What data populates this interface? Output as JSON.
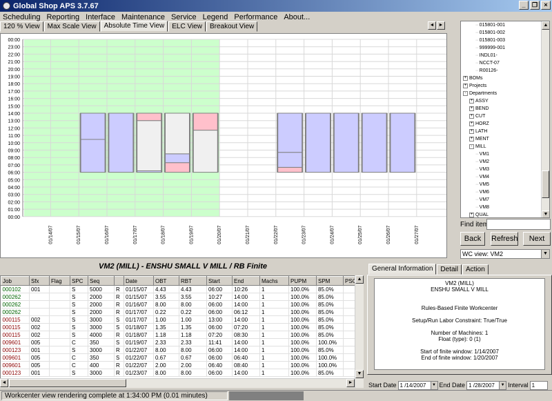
{
  "window": {
    "title": "Global Shop APS 3.7.67"
  },
  "menu": [
    "Scheduling",
    "Reporting",
    "Interface",
    "Maintenance",
    "Service",
    "Legend",
    "Performance",
    "About..."
  ],
  "view_tabs": [
    {
      "label": "120 % View",
      "active": false
    },
    {
      "label": "Max Scale View",
      "active": false
    },
    {
      "label": "Absolute Time View",
      "active": true
    },
    {
      "label": "ELC View",
      "active": false
    },
    {
      "label": "Breakout View",
      "active": false
    }
  ],
  "chart_data": {
    "type": "bar",
    "y_labels": [
      "00:00",
      "23:00",
      "22:00",
      "21:00",
      "20:00",
      "19:00",
      "18:00",
      "17:00",
      "16:00",
      "15:00",
      "14:00",
      "13:00",
      "12:00",
      "11:00",
      "10:00",
      "09:00",
      "08:00",
      "07:00",
      "06:00",
      "05:00",
      "04:00",
      "03:00",
      "02:00",
      "01:00",
      "00:00"
    ],
    "dates": [
      "01/14/07",
      "01/15/07",
      "01/16/07",
      "01/17/07",
      "01/18/07",
      "01/19/07",
      "01/20/07",
      "01/21/07",
      "01/22/07",
      "01/23/07",
      "01/24/07",
      "01/25/07",
      "01/26/07",
      "01/27/07"
    ],
    "finite_window": {
      "start": "01/14/07",
      "end": "01/20/07"
    },
    "days": [
      {
        "date": "01/15/07",
        "segments": [
          {
            "start": 6,
            "end": 10.45,
            "color": "#ccccff"
          },
          {
            "start": 10.45,
            "end": 14,
            "color": "#ccccff"
          }
        ]
      },
      {
        "date": "01/16/07",
        "segments": [
          {
            "start": 6,
            "end": 14,
            "color": "#ccccff"
          }
        ]
      },
      {
        "date": "01/17/07",
        "segments": [
          {
            "start": 6,
            "end": 6.2,
            "color": "#ccccff"
          },
          {
            "start": 6.2,
            "end": 13,
            "color": "#f0f0f0"
          },
          {
            "start": 13,
            "end": 14,
            "color": "#ffc0cb"
          }
        ]
      },
      {
        "date": "01/18/07",
        "segments": [
          {
            "start": 6,
            "end": 7.3,
            "color": "#ffc0cb"
          },
          {
            "start": 7.3,
            "end": 8.5,
            "color": "#ccccff"
          },
          {
            "start": 8.5,
            "end": 14,
            "color": "#f0f0f0"
          }
        ]
      },
      {
        "date": "01/19/07",
        "segments": [
          {
            "start": 6,
            "end": 11.7,
            "color": "#f0f0f0"
          },
          {
            "start": 11.7,
            "end": 14,
            "color": "#ffc0cb"
          }
        ]
      },
      {
        "date": "01/22/07",
        "segments": [
          {
            "start": 6,
            "end": 6.67,
            "color": "#ffc0cb"
          },
          {
            "start": 6.67,
            "end": 8.7,
            "color": "#ccccff"
          },
          {
            "start": 8.7,
            "end": 14,
            "color": "#ccccff"
          }
        ]
      },
      {
        "date": "01/23/07",
        "segments": [
          {
            "start": 6,
            "end": 14,
            "color": "#ccccff"
          }
        ]
      },
      {
        "date": "01/24/07",
        "segments": [
          {
            "start": 6,
            "end": 14,
            "color": "#ccccff"
          }
        ]
      },
      {
        "date": "01/25/07",
        "segments": [
          {
            "start": 6,
            "end": 14,
            "color": "#ccccff"
          }
        ]
      },
      {
        "date": "01/26/07",
        "segments": [
          {
            "start": 6,
            "end": 14,
            "color": "#ccccff"
          }
        ]
      }
    ]
  },
  "tree": [
    {
      "label": "015801-001",
      "level": 2,
      "exp": ""
    },
    {
      "label": "015801-002",
      "level": 2,
      "exp": ""
    },
    {
      "label": "015801-003",
      "level": 2,
      "exp": ""
    },
    {
      "label": "999999-001",
      "level": 2,
      "exp": ""
    },
    {
      "label": "INDL01-",
      "level": 2,
      "exp": ""
    },
    {
      "label": "NCCT-07",
      "level": 2,
      "exp": ""
    },
    {
      "label": "R00126-",
      "level": 2,
      "exp": ""
    },
    {
      "label": "BOMs",
      "level": 0,
      "exp": "+"
    },
    {
      "label": "Projects",
      "level": 0,
      "exp": "+"
    },
    {
      "label": "Departments",
      "level": 0,
      "exp": "-"
    },
    {
      "label": "ASSY",
      "level": 1,
      "exp": "+"
    },
    {
      "label": "BEND",
      "level": 1,
      "exp": "+"
    },
    {
      "label": "CUT",
      "level": 1,
      "exp": "+"
    },
    {
      "label": "HORZ",
      "level": 1,
      "exp": "+"
    },
    {
      "label": "LATH",
      "level": 1,
      "exp": "+"
    },
    {
      "label": "MENT",
      "level": 1,
      "exp": "+"
    },
    {
      "label": "MILL",
      "level": 1,
      "exp": "-"
    },
    {
      "label": "VM1",
      "level": 2,
      "exp": ""
    },
    {
      "label": "VM2",
      "level": 2,
      "exp": ""
    },
    {
      "label": "VM3",
      "level": 2,
      "exp": ""
    },
    {
      "label": "VM4",
      "level": 2,
      "exp": ""
    },
    {
      "label": "VM5",
      "level": 2,
      "exp": ""
    },
    {
      "label": "VM6",
      "level": 2,
      "exp": ""
    },
    {
      "label": "VM7",
      "level": 2,
      "exp": ""
    },
    {
      "label": "VM8",
      "level": 2,
      "exp": ""
    },
    {
      "label": "QUAL",
      "level": 1,
      "exp": "+"
    }
  ],
  "find": {
    "label": "Find item",
    "value": ""
  },
  "buttons": {
    "back": "Back",
    "refresh": "Refresh",
    "next": "Next"
  },
  "wc_view": "WC view: VM2",
  "wc_title": "VM2 (MILL) - ENSHU SMALL V MILL    / RB Finite",
  "grid": {
    "columns": [
      "Job",
      "Sfx",
      "Flag",
      "SPC",
      "Seq",
      "",
      "Date",
      "OBT",
      "RBT",
      "Start",
      "End",
      "Machs",
      "PUPM",
      "SPM",
      "PSC"
    ],
    "rows": [
      {
        "color": "#006400",
        "cells": [
          "000102",
          "001",
          "",
          "S",
          "5000",
          "R",
          "01/15/07",
          "4.43",
          "4.43",
          "06:00",
          "10:26",
          "1",
          "100.0%",
          "85.0%",
          ""
        ]
      },
      {
        "color": "#006400",
        "cells": [
          "000262",
          "",
          "",
          "S",
          "2000",
          "R",
          "01/15/07",
          "3.55",
          "3.55",
          "10:27",
          "14:00",
          "1",
          "100.0%",
          "85.0%",
          ""
        ]
      },
      {
        "color": "#006400",
        "cells": [
          "000262",
          "",
          "",
          "S",
          "2000",
          "R",
          "01/16/07",
          "8.00",
          "8.00",
          "06:00",
          "14:00",
          "1",
          "100.0%",
          "85.0%",
          ""
        ]
      },
      {
        "color": "#006400",
        "cells": [
          "000262",
          "",
          "",
          "S",
          "2000",
          "R",
          "01/17/07",
          "0.22",
          "0.22",
          "06:00",
          "06:12",
          "1",
          "100.0%",
          "85.0%",
          ""
        ]
      },
      {
        "color": "#8b0000",
        "cells": [
          "000115",
          "002",
          "",
          "S",
          "3000",
          "S",
          "01/17/07",
          "1.00",
          "1.00",
          "13:00",
          "14:00",
          "1",
          "100.0%",
          "85.0%",
          ""
        ]
      },
      {
        "color": "#8b0000",
        "cells": [
          "000115",
          "002",
          "",
          "S",
          "3000",
          "S",
          "01/18/07",
          "1.35",
          "1.35",
          "06:00",
          "07:20",
          "1",
          "100.0%",
          "85.0%",
          ""
        ]
      },
      {
        "color": "#8b0000",
        "cells": [
          "000115",
          "002",
          "",
          "S",
          "4000",
          "R",
          "01/18/07",
          "1.18",
          "1.18",
          "07:20",
          "08:30",
          "1",
          "100.0%",
          "85.0%",
          ""
        ]
      },
      {
        "color": "#8b0000",
        "cells": [
          "009601",
          "005",
          "",
          "C",
          "350",
          "S",
          "01/19/07",
          "2.33",
          "2.33",
          "11:41",
          "14:00",
          "1",
          "100.0%",
          "100.0%",
          ""
        ]
      },
      {
        "color": "#8b0000",
        "cells": [
          "000123",
          "001",
          "",
          "S",
          "3000",
          "R",
          "01/22/07",
          "8.00",
          "8.00",
          "06:00",
          "14:00",
          "1",
          "100.0%",
          "85.0%",
          ""
        ]
      },
      {
        "color": "#8b0000",
        "cells": [
          "009601",
          "005",
          "",
          "C",
          "350",
          "S",
          "01/22/07",
          "0.67",
          "0.67",
          "06:00",
          "06:40",
          "1",
          "100.0%",
          "100.0%",
          ""
        ]
      },
      {
        "color": "#8b0000",
        "cells": [
          "009601",
          "005",
          "",
          "C",
          "400",
          "R",
          "01/22/07",
          "2.00",
          "2.00",
          "06:40",
          "08:40",
          "1",
          "100.0%",
          "100.0%",
          ""
        ]
      },
      {
        "color": "#8b0000",
        "cells": [
          "000123",
          "001",
          "",
          "S",
          "3000",
          "R",
          "01/23/07",
          "8.00",
          "8.00",
          "06:00",
          "14:00",
          "1",
          "100.0%",
          "85.0%",
          ""
        ]
      }
    ]
  },
  "info_tabs": [
    {
      "label": "General Information",
      "active": true
    },
    {
      "label": "Detail",
      "active": false
    },
    {
      "label": "Action",
      "active": false
    }
  ],
  "info_lines": [
    "VM2 (MILL)",
    "ENSHU SMALL V MILL",
    "",
    "",
    "Rules-Based Finite Workcenter",
    "",
    "Setup/Run Labor Constraint: True/True",
    "",
    "Number of Machines: 1",
    "Float (type): 0 (1)",
    "",
    "Start of finite window: 1/14/2007",
    "End of finite window: 1/20/2007"
  ],
  "dates_bar": {
    "start_label": "Start Date",
    "start": "1 /14/2007",
    "end_label": "End Date",
    "end": "1 /28/2007",
    "interval_label": "Interval",
    "interval": "1"
  },
  "status": "Workcenter view rendering complete at 1:34:00 PM  (0.01 minutes)"
}
